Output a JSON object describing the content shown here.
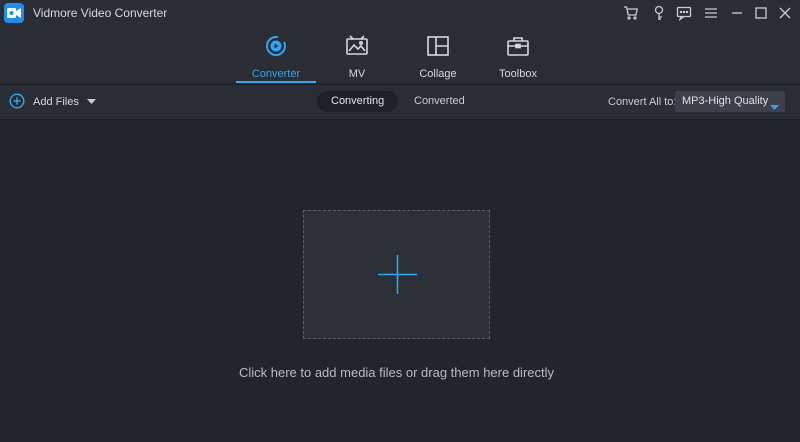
{
  "app": {
    "title": "Vidmore Video Converter"
  },
  "window_controls": [
    "cart-icon",
    "key-icon",
    "chat-icon",
    "menu-icon",
    "minimize-icon",
    "maximize-icon",
    "close-icon"
  ],
  "nav": {
    "tabs": [
      {
        "label": "Converter",
        "icon": "converter-icon",
        "active": true
      },
      {
        "label": "MV",
        "icon": "mv-icon",
        "active": false
      },
      {
        "label": "Collage",
        "icon": "collage-icon",
        "active": false
      },
      {
        "label": "Toolbox",
        "icon": "toolbox-icon",
        "active": false
      }
    ]
  },
  "toolbar": {
    "add_files_label": "Add Files",
    "tabs": [
      {
        "label": "Converting",
        "active": true
      },
      {
        "label": "Converted",
        "active": false
      }
    ],
    "convert_all_label": "Convert All to:",
    "format_value": "MP3-High Quality"
  },
  "main": {
    "drop_hint": "Click here to add media files or drag them here directly"
  },
  "colors": {
    "accent": "#2ea6f3",
    "background": "#23252d",
    "panel": "#2b2d35"
  }
}
